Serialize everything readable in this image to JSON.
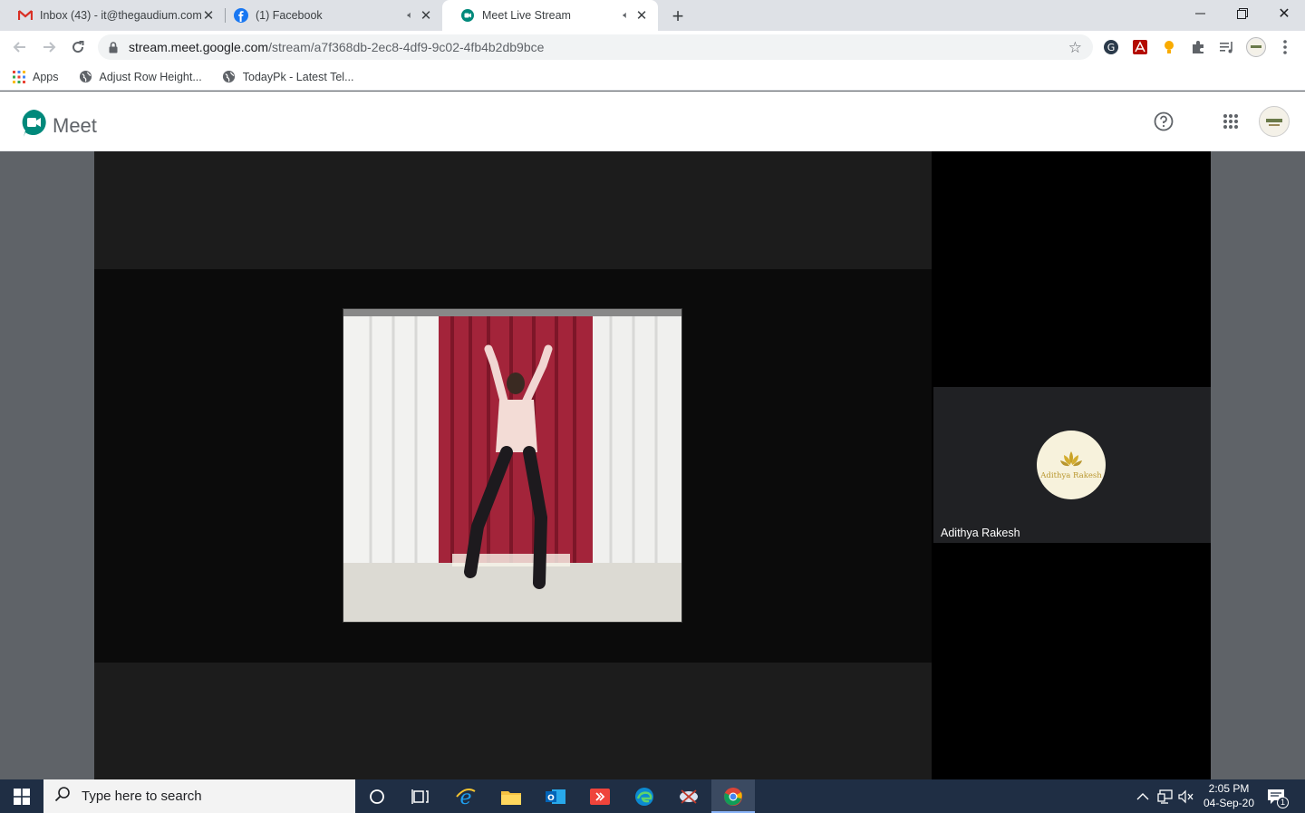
{
  "browser": {
    "tabs": [
      {
        "title": "Inbox (43) - it@thegaudium.com",
        "icon": "gmail-icon",
        "active": false
      },
      {
        "title": "(1) Facebook",
        "icon": "facebook-icon",
        "active": false
      },
      {
        "title": "Meet Live Stream",
        "icon": "meet-icon",
        "active": true
      }
    ],
    "url_host": "stream.meet.google.com",
    "url_path": "/stream/a7f368db-2ec8-4df9-9c02-4fb4b2db9bce",
    "bookmarks": [
      {
        "label": "Apps",
        "icon": "apps-grid-icon"
      },
      {
        "label": "Adjust Row Height...",
        "icon": "globe-icon"
      },
      {
        "label": "TodayPk - Latest Tel...",
        "icon": "globe-icon"
      }
    ]
  },
  "meet": {
    "product_name": "Meet",
    "participant_name": "Adithya Rakesh",
    "avatar_text": "Adithya Rakesh"
  },
  "taskbar": {
    "search_placeholder": "Type here to search",
    "time": "2:05 PM",
    "date": "04-Sep-20",
    "notification_count": "1"
  },
  "colors": {
    "meet_green": "#00897b",
    "taskbar_bg": "#1f2e44",
    "curtain_red": "#a3243a"
  }
}
